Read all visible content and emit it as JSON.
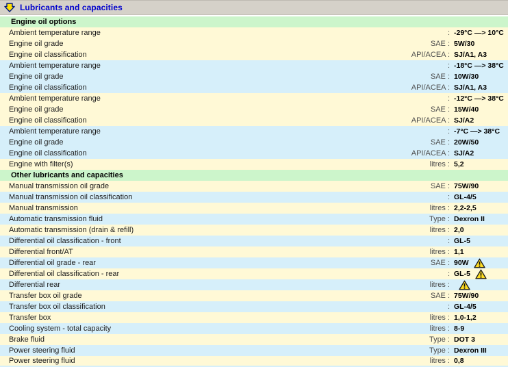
{
  "header": {
    "title": "Lubricants and capacities",
    "icon": "jump-down-arrow-icon"
  },
  "colors": {
    "titlebar_bg": "#d5d1c9",
    "title_text": "#0000cc",
    "section_bg": "#ccf5cb",
    "row_yellow": "#fff9d6",
    "row_blue": "#d6effa",
    "warning_fill": "#ffdd22",
    "warning_outline": "#1a1a1a"
  },
  "icons": {
    "header_icon": "jump-down-arrow-icon",
    "warning_icon": "warning-triangle-icon"
  },
  "sections": [
    {
      "title": "Engine oil options",
      "rows": [
        {
          "label": "Ambient temperature range",
          "unit": ":",
          "value": "-29°C —> 10°C",
          "bg": "yellow",
          "warning": false
        },
        {
          "label": "Engine oil grade",
          "unit": "SAE :",
          "value": "5W/30",
          "bg": "yellow",
          "warning": false
        },
        {
          "label": "Engine oil classification",
          "unit": "API/ACEA :",
          "value": "SJ/A1, A3",
          "bg": "yellow",
          "warning": false
        },
        {
          "label": "Ambient temperature range",
          "unit": ":",
          "value": "-18°C —> 38°C",
          "bg": "blue",
          "warning": false
        },
        {
          "label": "Engine oil grade",
          "unit": "SAE :",
          "value": "10W/30",
          "bg": "blue",
          "warning": false
        },
        {
          "label": "Engine oil classification",
          "unit": "API/ACEA :",
          "value": "SJ/A1, A3",
          "bg": "blue",
          "warning": false
        },
        {
          "label": "Ambient temperature range",
          "unit": ":",
          "value": "-12°C —> 38°C",
          "bg": "yellow",
          "warning": false
        },
        {
          "label": "Engine oil grade",
          "unit": "SAE :",
          "value": "15W/40",
          "bg": "yellow",
          "warning": false
        },
        {
          "label": "Engine oil classification",
          "unit": "API/ACEA :",
          "value": "SJ/A2",
          "bg": "yellow",
          "warning": false
        },
        {
          "label": "Ambient temperature range",
          "unit": ":",
          "value": "-7°C —> 38°C",
          "bg": "blue",
          "warning": false
        },
        {
          "label": "Engine oil grade",
          "unit": "SAE :",
          "value": "20W/50",
          "bg": "blue",
          "warning": false
        },
        {
          "label": "Engine oil classification",
          "unit": "API/ACEA :",
          "value": "SJ/A2",
          "bg": "blue",
          "warning": false
        },
        {
          "label": "Engine with filter(s)",
          "unit": "litres :",
          "value": "5,2",
          "bg": "yellow",
          "warning": false
        }
      ]
    },
    {
      "title": "Other lubricants and capacities",
      "rows": [
        {
          "label": "Manual transmission oil grade",
          "unit": "SAE :",
          "value": "75W/90",
          "bg": "yellow",
          "warning": false
        },
        {
          "label": "Manual transmission oil classification",
          "unit": ":",
          "value": "GL-4/5",
          "bg": "blue",
          "warning": false
        },
        {
          "label": "Manual transmission",
          "unit": "litres :",
          "value": "2,2-2,5",
          "bg": "yellow",
          "warning": false
        },
        {
          "label": "Automatic transmission fluid",
          "unit": "Type :",
          "value": "Dexron II",
          "bg": "blue",
          "warning": false
        },
        {
          "label": "Automatic transmission (drain & refill)",
          "unit": "litres :",
          "value": "2,0",
          "bg": "yellow",
          "warning": false
        },
        {
          "label": "Differential oil classification - front",
          "unit": ":",
          "value": "GL-5",
          "bg": "blue",
          "warning": false
        },
        {
          "label": "Differential front/AT",
          "unit": "litres :",
          "value": "1,1",
          "bg": "yellow",
          "warning": false
        },
        {
          "label": "Differential oil grade - rear",
          "unit": "SAE :",
          "value": "90W",
          "bg": "blue",
          "warning": true
        },
        {
          "label": "Differential oil classification - rear",
          "unit": ":",
          "value": "GL-5",
          "bg": "yellow",
          "warning": true
        },
        {
          "label": "Differential rear",
          "unit": "litres :",
          "value": "",
          "bg": "blue",
          "warning": true
        },
        {
          "label": "Transfer box oil grade",
          "unit": "SAE :",
          "value": "75W/90",
          "bg": "yellow",
          "warning": false
        },
        {
          "label": "Transfer box oil classification",
          "unit": ":",
          "value": "GL-4/5",
          "bg": "blue",
          "warning": false
        },
        {
          "label": "Transfer box",
          "unit": "litres :",
          "value": "1,0-1,2",
          "bg": "yellow",
          "warning": false
        },
        {
          "label": "Cooling system - total capacity",
          "unit": "litres :",
          "value": "8-9",
          "bg": "blue",
          "warning": false
        },
        {
          "label": "Brake fluid",
          "unit": "Type :",
          "value": "DOT 3",
          "bg": "yellow",
          "warning": false
        },
        {
          "label": "Power steering fluid",
          "unit": "Type :",
          "value": "Dexron III",
          "bg": "blue",
          "warning": false
        },
        {
          "label": "Power steering fluid",
          "unit": "litres :",
          "value": "0,8",
          "bg": "yellow",
          "warning": false
        }
      ]
    }
  ]
}
